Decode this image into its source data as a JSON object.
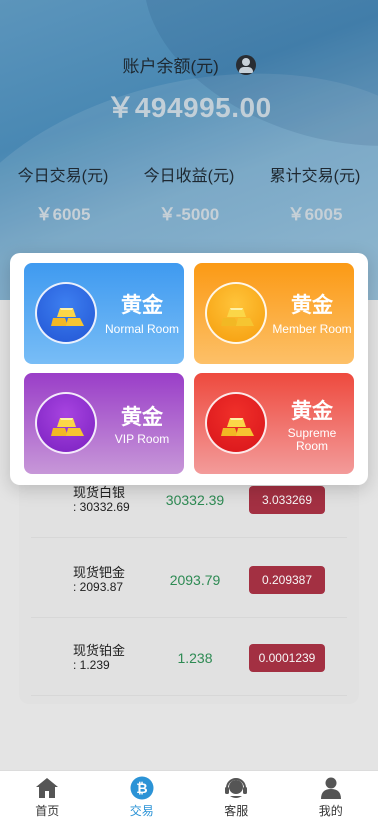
{
  "header": {
    "balance_label": "账户余额(元)",
    "balance_value": "￥494995.00",
    "stats": [
      {
        "label": "今日交易(元)",
        "value": "￥6005"
      },
      {
        "label": "今日收益(元)",
        "value": "￥-5000"
      },
      {
        "label": "累计交易(元)",
        "value": "￥6005"
      }
    ]
  },
  "rooms": [
    {
      "title": "黄金",
      "subtitle": "Normal Room"
    },
    {
      "title": "黄金",
      "subtitle": "Member Room"
    },
    {
      "title": "黄金",
      "subtitle": "VIP Room"
    },
    {
      "title": "黄金",
      "subtitle": "Supreme Room"
    }
  ],
  "market": [
    {
      "name": "现货白银",
      "sub": ": 30332.69",
      "price": "30332.39",
      "change": "3.033269"
    },
    {
      "name": "现货钯金",
      "sub": ": 2093.87",
      "price": "2093.79",
      "change": "0.209387"
    },
    {
      "name": "现货铂金",
      "sub": ": 1.239",
      "price": "1.238",
      "change": "0.0001239"
    }
  ],
  "tabs": [
    {
      "label": "首页",
      "icon": "home-icon"
    },
    {
      "label": "交易",
      "icon": "bitcoin-icon"
    },
    {
      "label": "客服",
      "icon": "headset-icon"
    },
    {
      "label": "我的",
      "icon": "user-icon"
    }
  ],
  "colors": {
    "accent": "#2b93d6",
    "price_green": "#2f8f56",
    "change_red": "#a93245",
    "normal_room": "#3f9af0",
    "member_room": "#fb9a15",
    "vip_room": "#9a3ec8",
    "supreme_room": "#ee4a3e"
  }
}
